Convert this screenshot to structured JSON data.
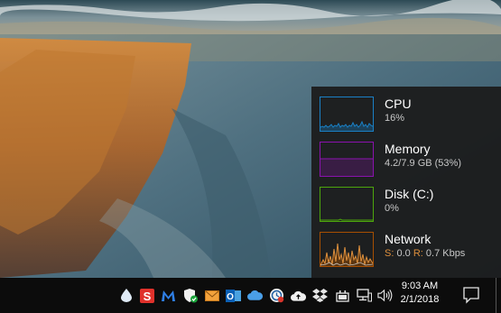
{
  "performance": {
    "cpu": {
      "label": "CPU",
      "value": "16%",
      "color": "#1a80c6"
    },
    "memory": {
      "label": "Memory",
      "value": "4.2/7.9 GB (53%)",
      "color": "#8b12ae"
    },
    "disk": {
      "label": "Disk (C:)",
      "value": "0%",
      "color": "#4da60c"
    },
    "network": {
      "label": "Network",
      "send_prefix": "S:",
      "send_value": "0.0",
      "recv_prefix": "R:",
      "recv_value": "0.7 Kbps",
      "color": "#a74f01",
      "accent": "#dd8f3c"
    }
  },
  "tray": {
    "icons": [
      "water-drop-icon",
      "s-app-icon",
      "malwarebytes-icon",
      "security-shield-icon",
      "mail-envelope-icon",
      "outlook-icon",
      "onedrive-icon",
      "sync-clock-icon",
      "upload-cloud-icon",
      "dropbox-icon",
      "power-plug-icon",
      "network-icon",
      "volume-icon"
    ]
  },
  "clock": {
    "time": "9:03 AM",
    "date": "2/1/2018"
  },
  "notification": {
    "icon": "action-center-icon"
  }
}
